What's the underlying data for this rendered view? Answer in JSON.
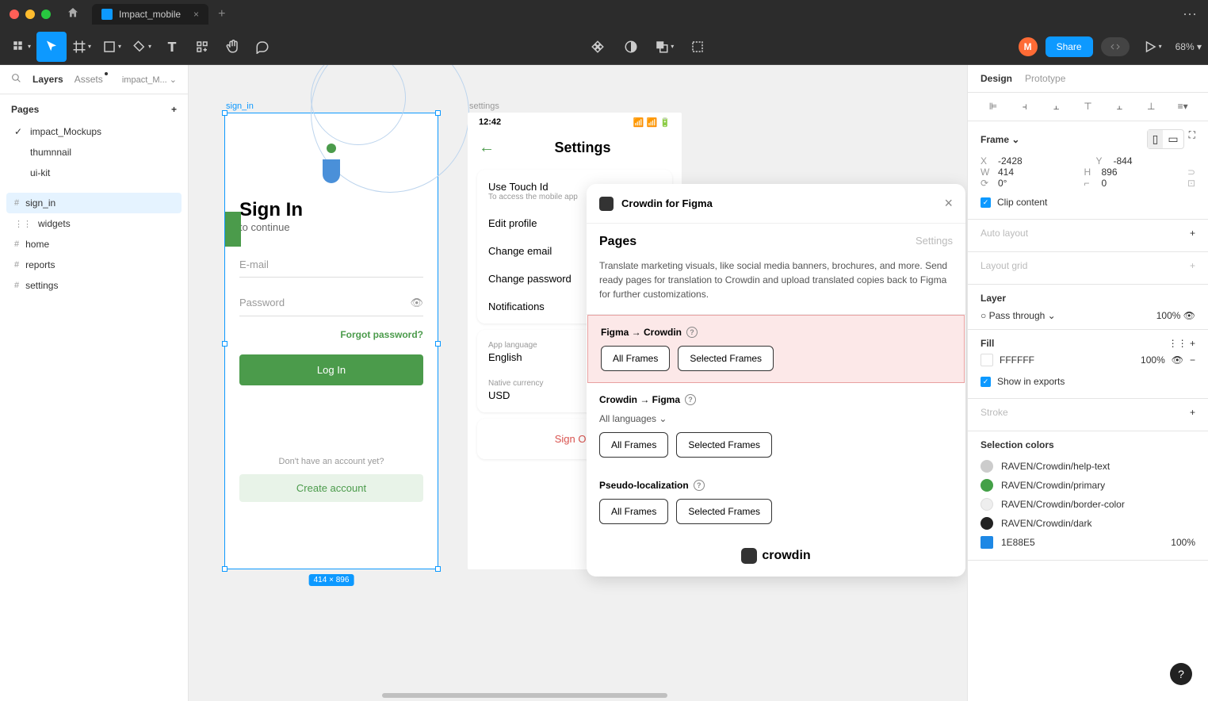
{
  "titlebar": {
    "tab_name": "Impact_mobile"
  },
  "toolbar": {
    "avatar_letter": "M",
    "share": "Share",
    "zoom": "68%"
  },
  "left_panel": {
    "tabs": {
      "layers": "Layers",
      "assets": "Assets",
      "crumb": "impact_M..."
    },
    "pages_header": "Pages",
    "pages": [
      {
        "name": "impact_Mockups",
        "checked": true
      },
      {
        "name": "thumnnail"
      },
      {
        "name": "ui-kit"
      },
      {
        "name": "sign_in",
        "selected": true,
        "icon": "#"
      },
      {
        "name": "widgets",
        "icon": "⋮⋮"
      },
      {
        "name": "home",
        "icon": "#"
      },
      {
        "name": "reports",
        "icon": "#"
      },
      {
        "name": "settings",
        "icon": "#"
      }
    ]
  },
  "canvas": {
    "signin": {
      "label": "sign_in",
      "title": "Sign In",
      "subtitle": "to continue",
      "email_ph": "E-mail",
      "password_ph": "Password",
      "forgot": "Forgot password?",
      "login": "Log In",
      "no_account": "Don't have an account yet?",
      "create": "Create account",
      "dimensions": "414 × 896"
    },
    "settings": {
      "label": "settings",
      "time": "12:42",
      "title": "Settings",
      "rows": {
        "touch_id": "Use Touch Id",
        "touch_sub": "To access the mobile app",
        "edit_profile": "Edit profile",
        "change_email": "Change email",
        "change_password": "Change password",
        "notifications": "Notifications",
        "app_lang_label": "App language",
        "app_lang": "English",
        "currency_label": "Native currency",
        "currency": "USD",
        "sign_out": "Sign Out"
      }
    }
  },
  "plugin": {
    "title": "Crowdin for Figma",
    "pages": "Pages",
    "settings": "Settings",
    "description": "Translate marketing visuals, like social media banners, brochures, and more. Send ready pages for translation to Crowdin and upload translated copies back to Figma for further customizations.",
    "section1": "Figma → Crowdin",
    "section2": "Crowdin → Figma",
    "section3": "Pseudo-localization",
    "all_languages": "All languages",
    "btn_all": "All Frames",
    "btn_selected": "Selected Frames",
    "footer": "crowdin"
  },
  "right_panel": {
    "tabs": {
      "design": "Design",
      "prototype": "Prototype"
    },
    "frame": "Frame",
    "x": "-2428",
    "y": "-844",
    "w": "414",
    "h": "896",
    "rotation": "0°",
    "corner": "0",
    "clip": "Clip content",
    "auto_layout": "Auto layout",
    "layout_grid": "Layout grid",
    "layer": "Layer",
    "blend": "Pass through",
    "opacity": "100%",
    "fill": "Fill",
    "fill_color": "FFFFFF",
    "fill_opacity": "100%",
    "show_exports": "Show in exports",
    "stroke": "Stroke",
    "selection_colors": "Selection colors",
    "colors": [
      {
        "name": "RAVEN/Crowdin/help-text",
        "hex": "#cccccc"
      },
      {
        "name": "RAVEN/Crowdin/primary",
        "hex": "#43a047"
      },
      {
        "name": "RAVEN/Crowdin/border-color",
        "hex": "#eeeeee"
      },
      {
        "name": "RAVEN/Crowdin/dark",
        "hex": "#222222"
      },
      {
        "name": "1E88E5",
        "hex": "#1e88e5",
        "opacity": "100%"
      }
    ]
  }
}
